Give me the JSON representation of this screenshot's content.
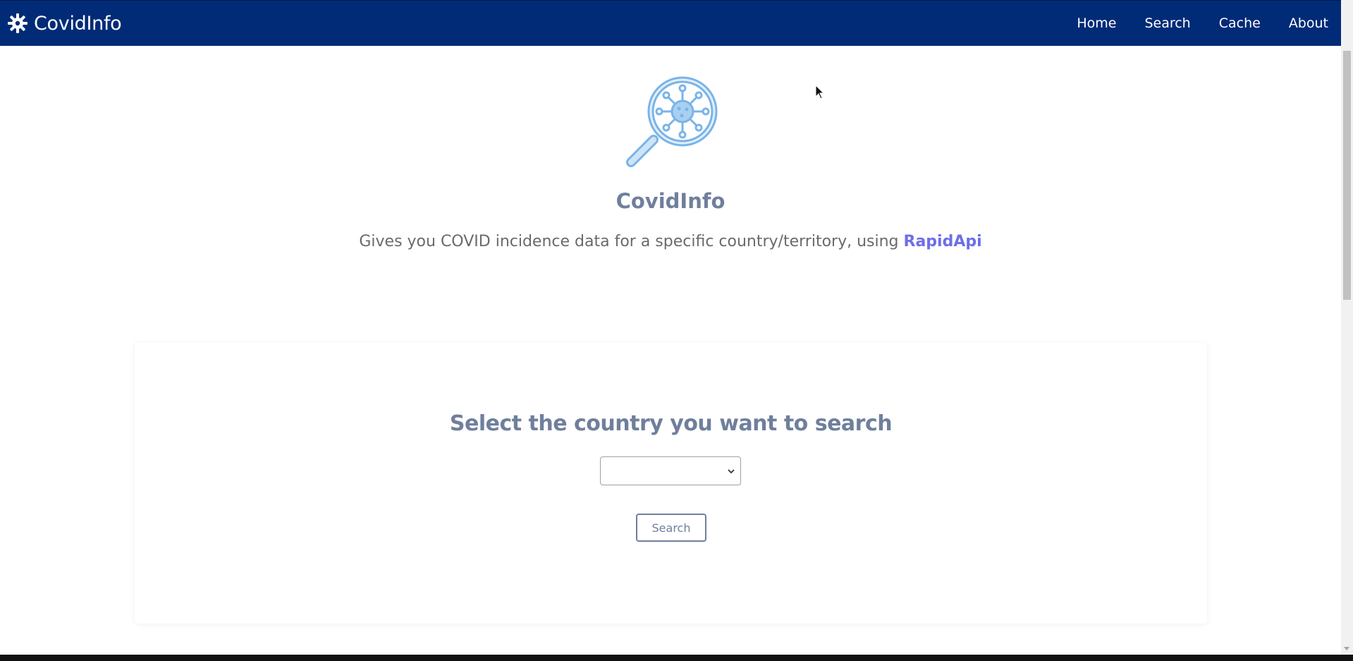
{
  "navbar": {
    "brand": "CovidInfo",
    "brand_icon": "virus-gear-icon",
    "links": [
      "Home",
      "Search",
      "Cache",
      "About"
    ]
  },
  "hero": {
    "logo_icon": "virus-magnifier-icon",
    "title": "CovidInfo",
    "description": "Gives you COVID incidence data for a specific country/territory, using ",
    "link_text": "RapidApi"
  },
  "search_card": {
    "title": "Select the country you want to search",
    "select_value": "",
    "button_label": "Search"
  },
  "colors": {
    "navbar_bg": "#012b77",
    "accent_text": "#6f7f9c",
    "link": "#6e6ee8",
    "icon_blue": "#79b4e8"
  }
}
